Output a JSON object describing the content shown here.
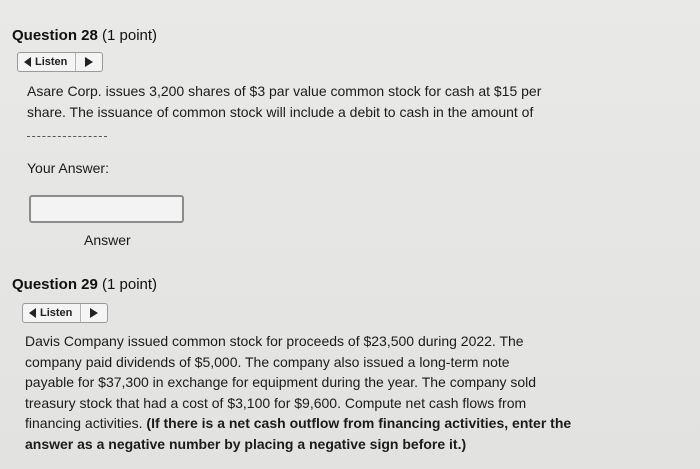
{
  "q28": {
    "title_bold": "Question 28",
    "title_rest": " (1 point)",
    "listen_label": "Listen",
    "text_line1": "Asare Corp. issues 3,200 shares of $3 par value common stock for cash at $15 per",
    "text_line2": "share. The issuance of common stock will include a debit to cash in the amount of",
    "your_answer_label": "Your Answer:",
    "answer_label": "Answer",
    "answer_value": ""
  },
  "q29": {
    "title_bold": "Question 29",
    "title_rest": " (1 point)",
    "listen_label": "Listen",
    "lines": [
      "Davis Company issued common stock for proceeds of $23,500 during 2022. The",
      "company paid dividends of $5,000. The company also issued a long-term note",
      "payable for $37,300 in exchange for equipment during the year. The company sold",
      "treasury stock that had a cost of $3,100 for $9,600. Compute net cash flows from"
    ],
    "line5_normal": "financing activities. ",
    "line5_bold": "(If there is a net cash outflow from financing activities, enter the",
    "line6_bold": "answer as a negative number by placing a negative sign before it.)"
  }
}
